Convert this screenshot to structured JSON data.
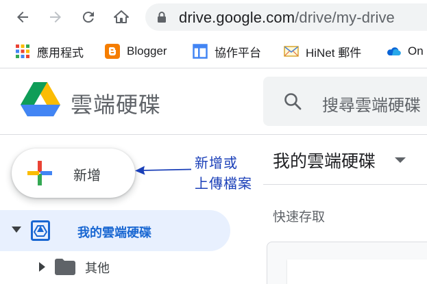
{
  "browser": {
    "url_host": "drive.google.com",
    "url_path": "/drive/my-drive",
    "bookmarks": [
      {
        "label": "應用程式",
        "icon": "apps-grid-icon"
      },
      {
        "label": "Blogger",
        "icon": "blogger-icon"
      },
      {
        "label": "協作平台",
        "icon": "sites-icon"
      },
      {
        "label": "HiNet 郵件",
        "icon": "mail-envelope-icon"
      },
      {
        "label": "On",
        "icon": "onedrive-cloud-icon"
      }
    ]
  },
  "drive": {
    "app_title": "雲端硬碟",
    "search_placeholder": "搜尋雲端硬碟",
    "new_button_label": "新增",
    "annotation": [
      "新增或",
      "上傳檔案"
    ],
    "sidebar": {
      "items": [
        {
          "label": "我的雲端硬碟",
          "active": true,
          "icon": "drive-icon"
        },
        {
          "label": "其他",
          "active": false,
          "icon": "folder-icon"
        }
      ]
    },
    "main": {
      "title": "我的雲端硬碟",
      "section_label": "快速存取"
    }
  },
  "colors": {
    "accent": "#1967d2",
    "active_bg": "#e8f0fe",
    "annotation": "#1a3fb8",
    "omnibox_bg": "#f1f3f4"
  }
}
